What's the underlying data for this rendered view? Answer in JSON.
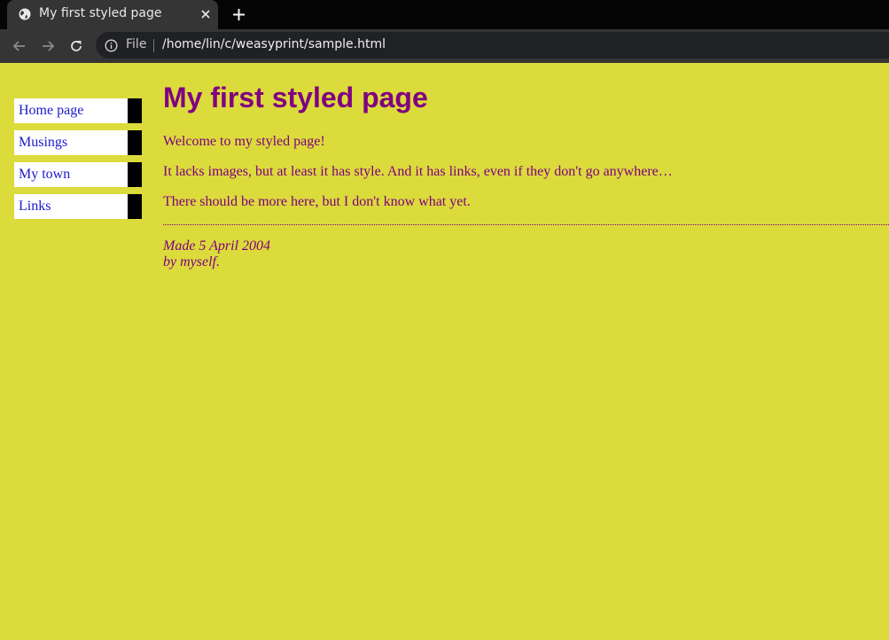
{
  "browser": {
    "tab": {
      "title": "My first styled page",
      "favicon": "globe-icon"
    },
    "toolbar": {
      "scheme_label": "File",
      "url": "/home/lin/c/weasyprint/sample.html"
    }
  },
  "page": {
    "colors": {
      "background": "#dbdb3c",
      "text": "#800080",
      "link": "#1a1acc",
      "nav_item_bg": "#ffffff",
      "nav_item_border": "#000000"
    },
    "navbar": {
      "items": [
        {
          "label": "Home page"
        },
        {
          "label": "Musings"
        },
        {
          "label": "My town"
        },
        {
          "label": "Links"
        }
      ]
    },
    "heading": "My first styled page",
    "paragraphs": [
      "Welcome to my styled page!",
      "It lacks images, but at least it has style. And it has links, even if they don't go anywhere…",
      "There should be more here, but I don't know what yet."
    ],
    "address": {
      "line1": "Made 5 April 2004",
      "line2": "by myself."
    }
  }
}
